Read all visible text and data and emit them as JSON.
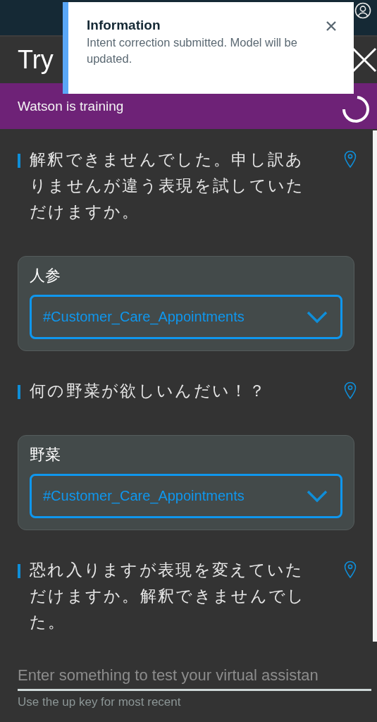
{
  "toast": {
    "title": "Information",
    "message": "Intent correction submitted. Model will be updated."
  },
  "panel": {
    "title": "Try"
  },
  "status_banner": {
    "text": "Watson is training"
  },
  "messages": [
    {
      "kind": "bot",
      "text": "解釈できませんでした。申し訳ありませんが違う表現を試していただけますか。"
    },
    {
      "kind": "user",
      "text": "人参",
      "intent": "#Customer_Care_Appointments"
    },
    {
      "kind": "bot",
      "text": "何の野菜が欲しいんだい！？"
    },
    {
      "kind": "user",
      "text": "野菜",
      "intent": "#Customer_Care_Appointments"
    },
    {
      "kind": "bot",
      "text": "恐れ入りますが表現を変えていただけますか。解釈できませんでした。"
    }
  ],
  "input": {
    "placeholder": "Enter something to test your virtual assistan",
    "helper": "Use the up key for most recent"
  }
}
